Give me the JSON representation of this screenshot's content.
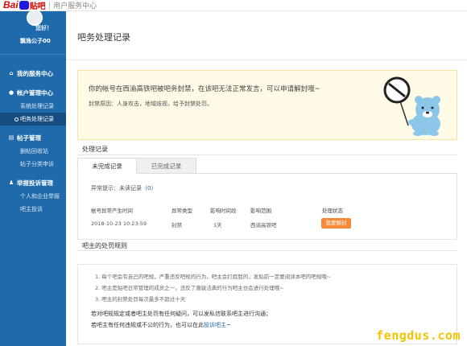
{
  "header": {
    "logo_bai": "Bai",
    "logo_tieba": "贴吧",
    "center_label": "用户服务中心"
  },
  "user": {
    "greeting": "您好！",
    "name": "飘逸公子00"
  },
  "sidebar": {
    "groups": [
      {
        "icon": "home-icon",
        "label": "我的服务中心",
        "items": []
      },
      {
        "icon": "user-icon",
        "label": "帐户管理中心",
        "items": [
          "系统处理记录",
          "吧务处理记录"
        ]
      },
      {
        "icon": "post-icon",
        "label": "帖子管理",
        "items": [
          "删帖回收站",
          "帖子分类申诉"
        ]
      },
      {
        "icon": "report-icon",
        "label": "举报投诉管理",
        "items": [
          "个人和企业举报",
          "吧主投诉"
        ]
      }
    ]
  },
  "page": {
    "title": "吧务处理记录"
  },
  "notice": {
    "message": "你的帐号在西渝高铁吧被吧务封禁，在该吧无法正常发言，可以申请解封哦~",
    "reason": "封禁原因：人身攻击，地域歧视，给予封禁处罚。"
  },
  "records": {
    "section_title": "处理记录",
    "tabs": [
      "未完成记录",
      "已完成记录"
    ],
    "abnormal_prefix": "异常提示：未读记录（",
    "abnormal_count": "0",
    "abnormal_suffix": "）",
    "columns": [
      "帐号异常产生时间",
      "异常类型",
      "影响时间段",
      "影响范围",
      "处理状态"
    ],
    "rows": [
      {
        "time": "2018-10-23 10:23:59",
        "type": "封禁",
        "duration": "1天",
        "scope": "西渝高铁吧",
        "action": "我要解封"
      }
    ]
  },
  "rules": {
    "section_title": "吧主的处罚规则",
    "items": [
      "1. 每个吧会有自己的吧规，严重违反吧规的行为，吧主会打屁屁的，发贴前一定要阅读本吧的吧规哦~",
      "2. 吧主是贴吧日常管理的成员之一，违反了唐骏法典的行为吧主也会进行处理哦~",
      "3. 吧主的封禁处罚每次最多不超过十天"
    ],
    "note1": "若对吧规规定或者吧主处罚有任何疑问，可以发私信联系吧主进行沟通；",
    "note2_prefix": "若吧主有任何违规或不公的行为，也可以在此",
    "note2_link": "投诉吧主",
    "note2_suffix": "~"
  },
  "watermark": "fengdus.com",
  "colors": {
    "sidebar": "#1e6aab",
    "accent_button": "#f6883a",
    "notice_bg": "#fffbe6",
    "watermark": "#f3c400"
  }
}
